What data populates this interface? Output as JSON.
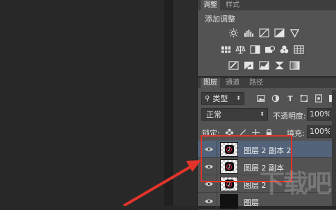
{
  "adjustments_panel": {
    "tabs": [
      "调整",
      "样式"
    ],
    "title": "添加调整",
    "rows": [
      [
        "brightness-contrast-icon",
        "levels-icon",
        "curves-icon",
        "exposure-icon",
        "vibrance-icon"
      ],
      [
        "hue-saturation-icon",
        "color-balance-icon",
        "black-white-icon",
        "photo-filter-icon",
        "channel-mixer-icon",
        "color-lookup-icon"
      ],
      [
        "invert-icon",
        "posterize-icon",
        "threshold-icon",
        "selective-color-icon",
        "gradient-map-icon"
      ]
    ]
  },
  "layers_panel": {
    "tabs": [
      "图层",
      "通道",
      "路径"
    ],
    "filter": {
      "label": "类型"
    },
    "blend_mode": "正常",
    "opacity_label": "不透明度:",
    "opacity_value": "100%",
    "lock_label": "锁定:",
    "fill_label": "填充:",
    "fill_value": "100%",
    "layers": [
      {
        "name": "图层 2 副本 2",
        "selected": true
      },
      {
        "name": "图层 2 副本",
        "selected": false
      },
      {
        "name": "图层 2",
        "selected": false
      },
      {
        "name": "图层",
        "selected": false
      }
    ]
  },
  "colors": {
    "highlight_box": "#e0342b",
    "selection": "#52637a"
  },
  "watermark": "下载吧"
}
